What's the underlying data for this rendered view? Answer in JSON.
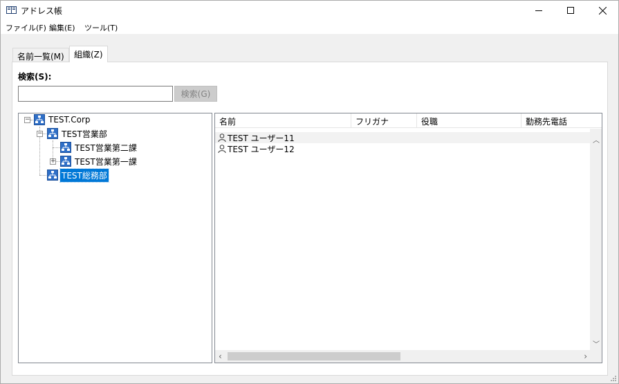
{
  "window": {
    "title": "アドレス帳",
    "min_icon": "minimize-icon",
    "max_icon": "maximize-icon",
    "close_icon": "close-icon"
  },
  "menu": {
    "file": "ファイル(F)",
    "edit": "編集(E)",
    "tools": "ツール(T)"
  },
  "tabs": {
    "names": "名前一覧(M)",
    "org": "組織(Z)",
    "active": "org"
  },
  "search": {
    "label": "検索(S):",
    "value": "",
    "placeholder": "",
    "button": "検索(G)",
    "button_enabled": false
  },
  "tree": {
    "root": "TEST.Corp",
    "sales": "TEST営業部",
    "sales2": "TEST営業第二課",
    "sales1": "TEST営業第一課",
    "general": "TEST総務部",
    "selected": "TEST総務部",
    "node_icon": "org-chart-icon"
  },
  "list": {
    "columns": [
      "名前",
      "フリガナ",
      "役職",
      "勤務先電話"
    ],
    "rows": [
      {
        "name": "TEST ユーザー11",
        "kana": "",
        "title": "",
        "phone": ""
      },
      {
        "name": "TEST ユーザー12",
        "kana": "",
        "title": "",
        "phone": ""
      }
    ],
    "row_icon": "user-icon"
  },
  "colors": {
    "selection": "#0078d7",
    "window_bg": "#f0f0f0",
    "tree_icon_blue": "#2f6fc7"
  }
}
